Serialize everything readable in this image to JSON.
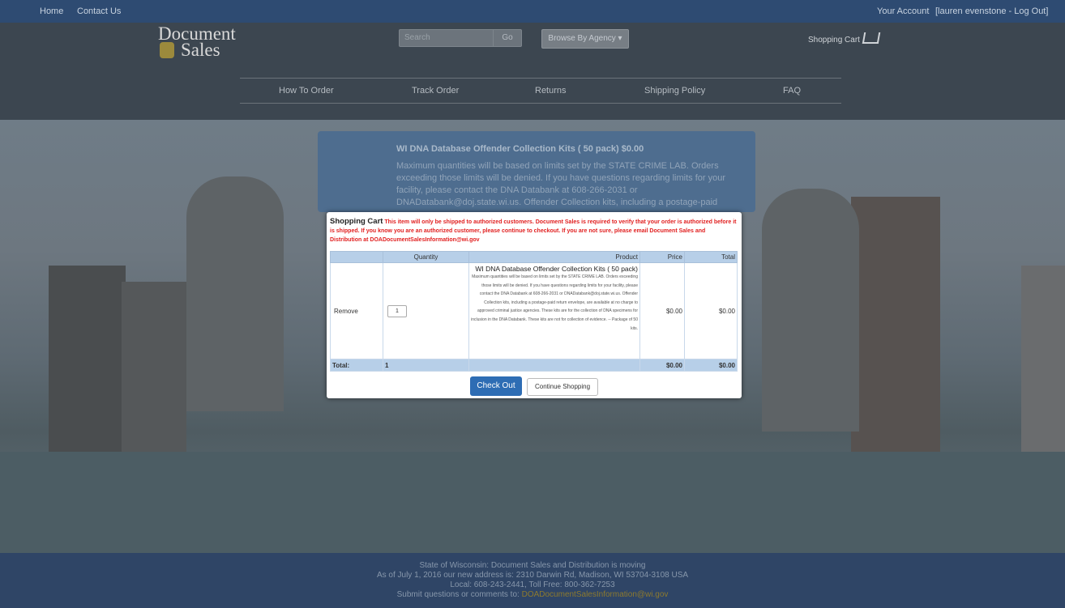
{
  "topbar": {
    "home": "Home",
    "contact": "Contact Us",
    "account": "Your Account",
    "user": "[lauren evenstone - Log Out]"
  },
  "header": {
    "logo_line1": "Document",
    "logo_line2": "Sales",
    "search_placeholder": "Search",
    "search_go": "Go",
    "browse_agency": "Browse By Agency ▾",
    "shopping_cart": "Shopping Cart"
  },
  "nav": [
    "How To Order",
    "Track Order",
    "Returns",
    "Shipping Policy",
    "FAQ"
  ],
  "background_product": {
    "title": "WI DNA Database Offender Collection Kits ( 50 pack)  $0.00",
    "text": "Maximum quantities will be based on limits set by the STATE CRIME LAB. Orders exceeding those limits will be denied. If you have questions regarding limits for your facility, please contact the DNA Databank at 608-266-2031 or DNADatabank@doj.state.wi.us. Offender Collection kits, including a postage-paid"
  },
  "cart_modal": {
    "heading": "Shopping Cart",
    "warning": "This item will only be shipped to authorized customers. Document Sales is required to verify that your order is authorized before it is shipped. If you know you are an authorized customer, please continue to checkout. If you are not sure, please email Document Sales and Distribution at DOADocumentSalesInformation@wi.gov",
    "columns": {
      "quantity": "Quantity",
      "product": "Product",
      "price": "Price",
      "total": "Total"
    },
    "row": {
      "remove": "Remove",
      "quantity": "1",
      "product_title": "WI DNA Database Offender Collection Kits ( 50 pack)",
      "product_desc": "Maximum quantities will be based on limits set by the STATE CRIME LAB. Orders exceeding those limits will be denied. If you have questions regarding limits for your facility, please contact the DNA Databank at 608-266-2031 or DNADatabank@doj.state.wi.us. Offender Collection kits, including a postage-paid return envelope, are available at no charge to approved criminal justice agencies. These kits are for the collection of DNA specimens for inclusion in the DNA Databank. These kits are not for collection of evidence. -- Package of 50 kits.",
      "price": "$0.00",
      "total": "$0.00"
    },
    "totals": {
      "label": "Total:",
      "quantity": "1",
      "price": "$0.00",
      "total": "$0.00"
    },
    "checkout": "Check Out",
    "continue": "Continue Shopping"
  },
  "footer": {
    "line1": "State of Wisconsin: Document Sales and Distribution is moving",
    "line2": "As of July 1, 2016 our new address is: 2310 Darwin Rd, Madison, WI 53704-3108 USA",
    "line3": "Local: 608-243-2441, Toll Free: 800-362-7253",
    "line4_prefix": "Submit questions or comments to:",
    "line4_email": "DOADocumentSalesInformation@wi.gov"
  }
}
